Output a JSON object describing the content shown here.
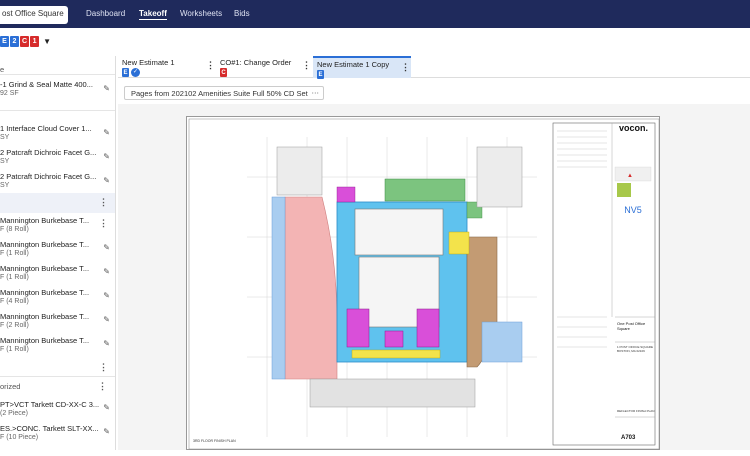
{
  "topbar": {
    "project": "ost Office Square",
    "nav": [
      "Dashboard",
      "Takeoff",
      "Worksheets",
      "Bids"
    ],
    "active": "Takeoff"
  },
  "badges": [
    {
      "label": "E",
      "color": "#2b6fd6"
    },
    {
      "label": "2",
      "color": "#2b6fd6"
    },
    {
      "label": "C",
      "color": "#d62b2b"
    },
    {
      "label": "1",
      "color": "#d62b2b"
    }
  ],
  "sidebar": {
    "group_top": "e",
    "items": [
      {
        "title": "-1 Grind & Seal Matte 400...",
        "sub": "92 SF"
      },
      {
        "title": "1 Interface Cloud Cover 1...",
        "sub": "SY"
      },
      {
        "title": "2 Patcraft Dichroic Facet G...",
        "sub": "SY"
      },
      {
        "title": "2 Patcraft Dichroic Facet G...",
        "sub": "SY"
      },
      {
        "title": "Mannington Burkebase T...",
        "sub": "F (8 Roll)"
      },
      {
        "title": "Mannington Burkebase T...",
        "sub": "F (1 Roll)"
      },
      {
        "title": "Mannington Burkebase T...",
        "sub": "F (1 Roll)"
      },
      {
        "title": "Mannington Burkebase T...",
        "sub": "F (4 Roll)"
      },
      {
        "title": "Mannington Burkebase T...",
        "sub": "F (2 Roll)"
      },
      {
        "title": "Mannington Burkebase T...",
        "sub": "F (1 Roll)"
      },
      {
        "title": "PT>VCT Tarkett CD-XX-C 3...",
        "sub": "(2 Piece)"
      },
      {
        "title": "ES.>CONC. Tarkett SLT-XX...",
        "sub": "F (10 Piece)"
      }
    ],
    "group_uncat": "orized"
  },
  "tabs": [
    {
      "label": "New Estimate 1",
      "badge": "E",
      "badge_color": "#2b6fd6",
      "selected": false
    },
    {
      "label": "CO#1: Change Order",
      "badge": "C",
      "badge_color": "#d62b2b",
      "selected": false
    },
    {
      "label": "New Estimate 1 Copy",
      "badge": "E",
      "badge_color": "#2b6fd6",
      "selected": true
    }
  ],
  "sheet_select": "Pages from 202102 Amenities Suite Full 50% CD Set",
  "titleblock": {
    "logo": "vocon.",
    "project_name": "One Post Office Square",
    "address": "1 POST OFFICE SQUARE BOSTON, MA 02109",
    "drawing_title": "REFLECTOR FINISH PLAN",
    "sheet_no": "A703"
  },
  "plan_title": "3RD FLOOR FINISH PLAN",
  "colors": {
    "topbar": "#1f2a5c",
    "accent": "#2b6fd6",
    "floor_blue": "#5fc2ee",
    "floor_pink": "#f3b4b4",
    "floor_green": "#7cc47f",
    "floor_magenta": "#d94fd9",
    "floor_brown": "#c39b73",
    "floor_yellow": "#f3e34b"
  }
}
